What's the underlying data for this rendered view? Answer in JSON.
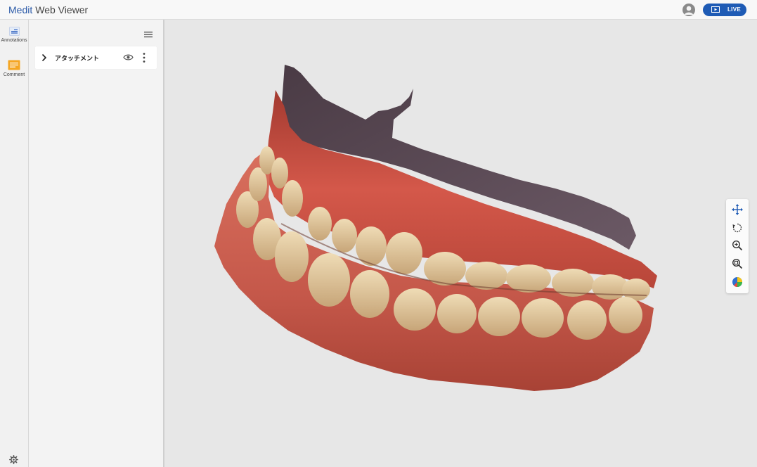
{
  "header": {
    "brand_part1": "Medit",
    "brand_part2": "Web Viewer",
    "live_label": "LIVE",
    "icons": [
      "user-avatar-icon",
      "live-screen-icon"
    ]
  },
  "sidebar": {
    "items": [
      {
        "label": "Annotations",
        "icon": "annotations-icon"
      },
      {
        "label": "Comment",
        "icon": "comment-icon"
      }
    ],
    "settings_icon": "gear-icon"
  },
  "panel": {
    "menu_icon": "hamburger-menu-icon",
    "layers": [
      {
        "label": "アタッチメント",
        "icons": [
          "chevron-right-icon",
          "eye-icon",
          "kebab-menu-icon"
        ]
      }
    ]
  },
  "viewer": {
    "content": "3d-dental-scan",
    "tools": [
      "pan-icon",
      "rotate-icon",
      "zoom-in-icon",
      "zoom-fit-icon",
      "color-map-icon"
    ]
  },
  "colors": {
    "accent": "#1e5bb5",
    "gum": "#c0483a",
    "tooth": "#d9be8f",
    "palate": "#5d4d57"
  }
}
